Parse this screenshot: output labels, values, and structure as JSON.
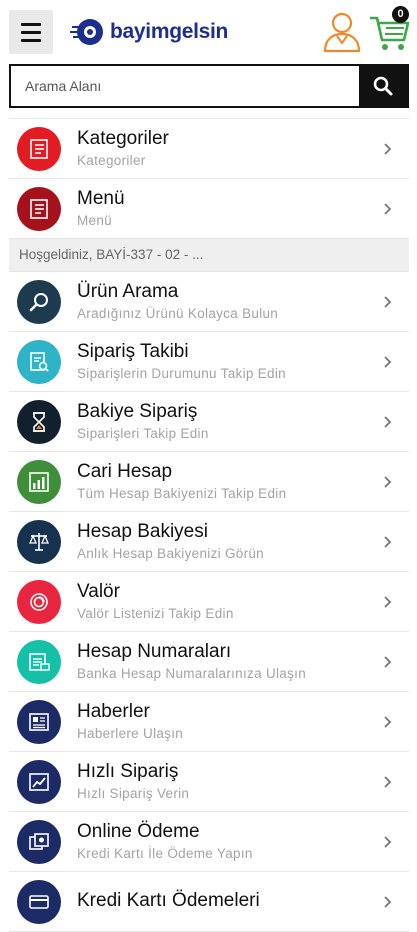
{
  "header": {
    "logo_text": "bayimgelsin",
    "cart_count": "0"
  },
  "search": {
    "placeholder": "Arama Alanı"
  },
  "top_items": [
    {
      "title": "Kategoriler",
      "subtitle": "Kategoriler",
      "color": "#e31b23",
      "icon": "list-icon"
    },
    {
      "title": "Menü",
      "subtitle": "Menü",
      "color": "#a5121b",
      "icon": "list-icon"
    }
  ],
  "welcome_text": "Hoşgeldiniz, BAYİ-337 - 02 - ...",
  "items": [
    {
      "title": "Ürün Arama",
      "subtitle": "Aradığınız Ürünü Kolayca Bulun",
      "color": "#1e3a4f",
      "icon": "magnifier-icon"
    },
    {
      "title": "Sipariş Takibi",
      "subtitle": "Siparişlerin Durumunu Takip Edin",
      "color": "#2fb3c6",
      "icon": "document-search-icon"
    },
    {
      "title": "Bakiye Sipariş",
      "subtitle": "Siparişleri Takip Edin",
      "color": "#11202c",
      "icon": "hourglass-icon"
    },
    {
      "title": "Cari Hesap",
      "subtitle": "Tüm Hesap Bakiyenizi Takip Edin",
      "color": "#3f8e3a",
      "icon": "bar-chart-icon"
    },
    {
      "title": "Hesap Bakiyesi",
      "subtitle": "Anlık Hesap Bakiyenizi Görün",
      "color": "#16324f",
      "icon": "scale-icon"
    },
    {
      "title": "Valör",
      "subtitle": "Valör Listenizi Takip Edin",
      "color": "#e8263f",
      "icon": "target-icon"
    },
    {
      "title": "Hesap Numaraları",
      "subtitle": "Banka Hesap Numaralarınıza Ulaşın",
      "color": "#15c0a6",
      "icon": "card-list-icon"
    },
    {
      "title": "Haberler",
      "subtitle": "Haberlere Ulaşın",
      "color": "#1c2a66",
      "icon": "newspaper-icon"
    },
    {
      "title": "Hızlı Sipariş",
      "subtitle": "Hızlı Sipariş Verin",
      "color": "#1c2a66",
      "icon": "trend-chart-icon"
    },
    {
      "title": "Online Ödeme",
      "subtitle": "Kredi Kartı İle Ödeme Yapın",
      "color": "#1c2a66",
      "icon": "money-icon"
    },
    {
      "title": "Kredi Kartı Ödemeleri",
      "subtitle": "",
      "color": "#1c2a66",
      "icon": "credit-card-icon"
    }
  ]
}
